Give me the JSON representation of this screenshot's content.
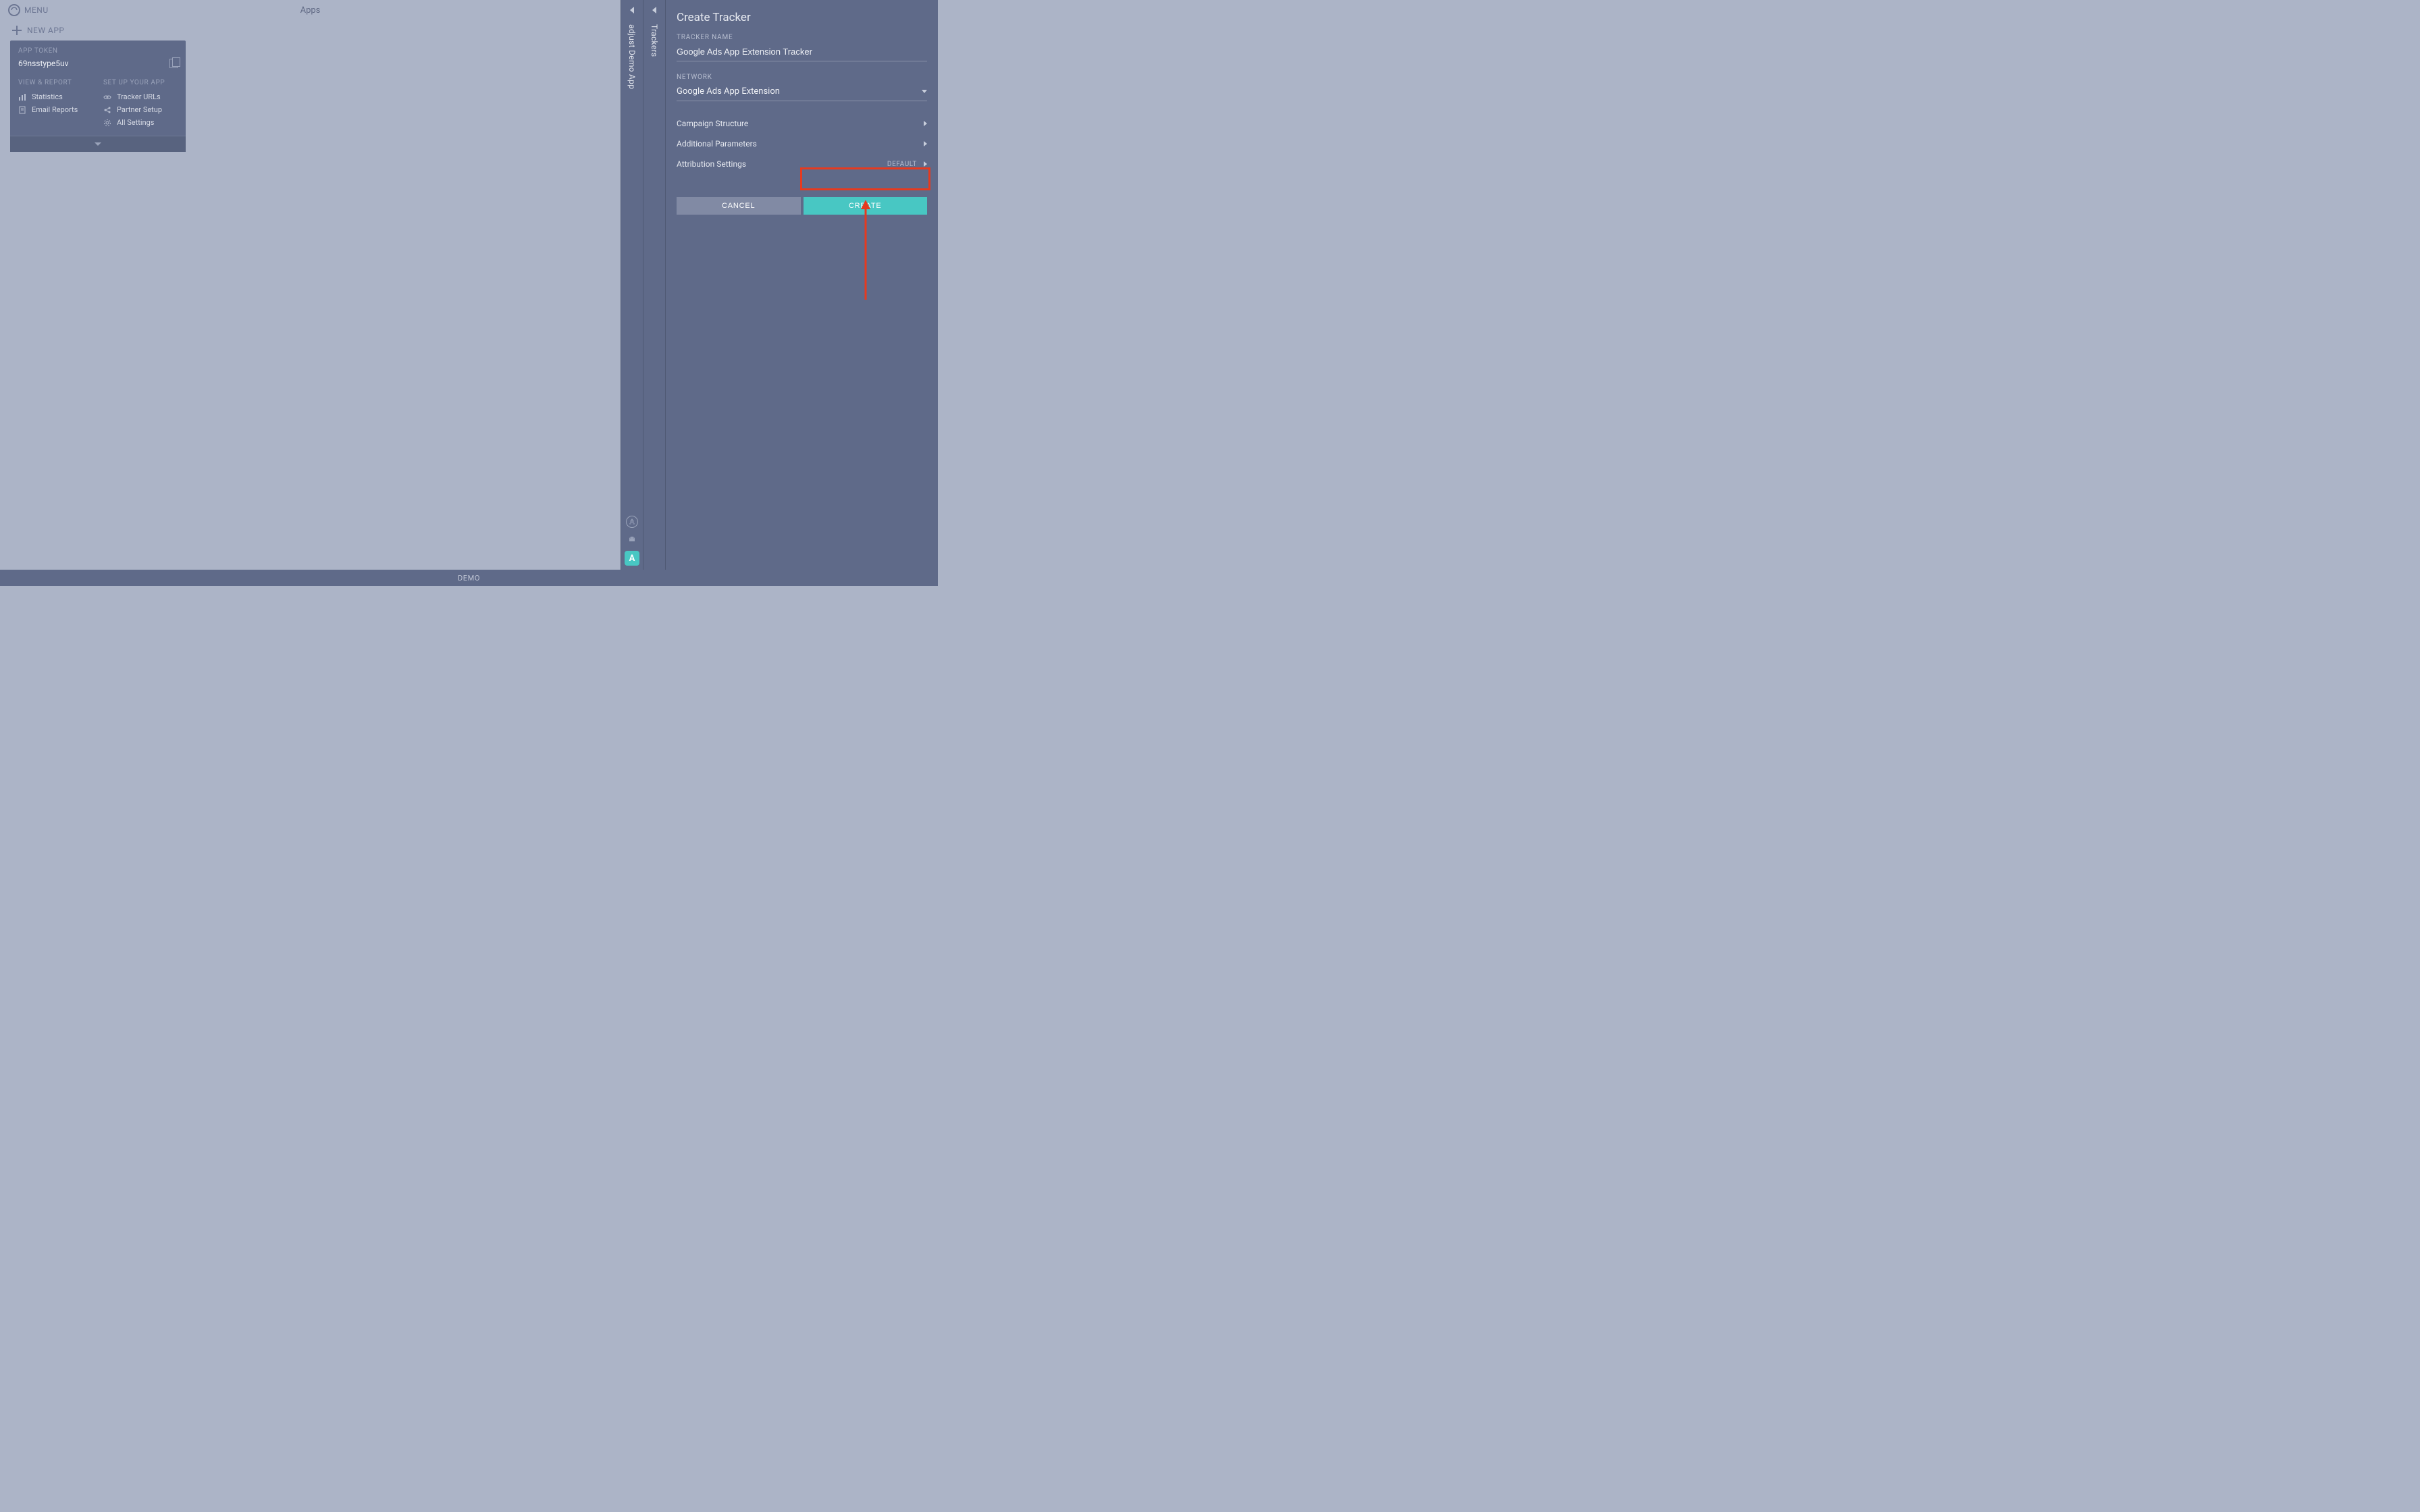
{
  "header": {
    "menu_label": "MENU",
    "center_title": "Apps",
    "new_app_label": "NEW APP"
  },
  "app_card": {
    "token_label": "APP TOKEN",
    "token_value": "69nsstype5uv",
    "view_report_label": "VIEW & REPORT",
    "setup_label": "SET UP YOUR APP",
    "links_left": [
      {
        "label": "Statistics"
      },
      {
        "label": "Email Reports"
      }
    ],
    "links_right": [
      {
        "label": "Tracker URLs"
      },
      {
        "label": "Partner Setup"
      },
      {
        "label": "All Settings"
      }
    ]
  },
  "rails": {
    "app_rail_label": "adjust Demo App",
    "trackers_rail_label": "Trackers",
    "badge_letter": "A"
  },
  "panel": {
    "title": "Create Tracker",
    "tracker_name_label": "TRACKER NAME",
    "tracker_name_value": "Google Ads App Extension Tracker",
    "network_label": "NETWORK",
    "network_value": "Google Ads App Extension",
    "rows": {
      "campaign_structure": "Campaign Structure",
      "additional_parameters": "Additional Parameters",
      "attribution_settings": "Attribution Settings",
      "attribution_default": "DEFAULT"
    },
    "cancel_label": "CANCEL",
    "create_label": "CREATE"
  },
  "footer": {
    "demo_label": "DEMO"
  }
}
